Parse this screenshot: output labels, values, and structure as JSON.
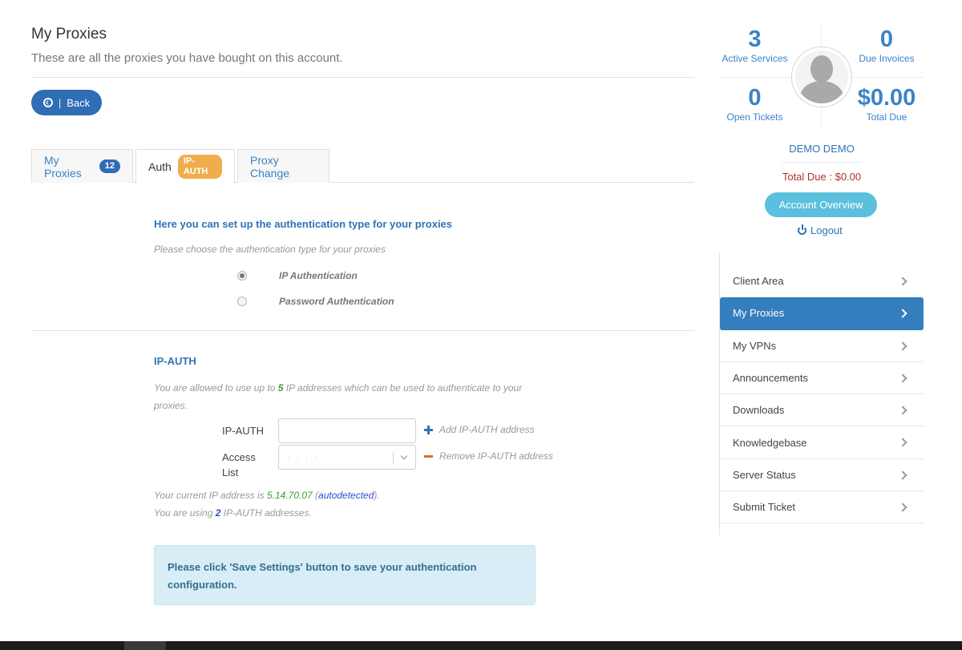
{
  "header": {
    "title": "My Proxies",
    "subtitle": "These are all the proxies you have bought on this account.",
    "back_label": "Back",
    "back_sep": "|"
  },
  "tabs": [
    {
      "label": "My Proxies",
      "badge": "12"
    },
    {
      "label": "Auth",
      "badge": "IP-AUTH"
    },
    {
      "label": "Proxy Change"
    }
  ],
  "auth": {
    "title": "Here you can set up the authentication type for your proxies",
    "hint": "Please choose the authentication type for your proxies",
    "options": [
      {
        "label": "IP Authentication",
        "checked": true
      },
      {
        "label": "Password Authentication",
        "checked": false
      }
    ]
  },
  "ipauth": {
    "title": "IP-AUTH",
    "allowed_prefix": "You are allowed to use up to ",
    "allowed_count": "5",
    "allowed_suffix": " IP addresses which can be used to authenticate to your proxies.",
    "input_label": "IP-AUTH",
    "input_value": "",
    "access_label": "Access List",
    "access_value": "·  ·  ·  ·",
    "add_label": "Add IP-AUTH address",
    "remove_label": "Remove IP-AUTH address",
    "current_prefix": "Your current IP address is ",
    "current_ip": "5.14.70.07",
    "current_paren_open": " (",
    "autodetected": "autodetected",
    "current_paren_close": ").",
    "using_prefix": "You are using ",
    "using_count": "2",
    "using_suffix": " IP-AUTH addresses.",
    "save_notice": "Please click 'Save Settings' button to save your authentication configuration."
  },
  "stats": {
    "active_services": {
      "value": "3",
      "label": "Active Services"
    },
    "due_invoices": {
      "value": "0",
      "label": "Due Invoices"
    },
    "open_tickets": {
      "value": "0",
      "label": "Open Tickets"
    },
    "total_due": {
      "value": "$0.00",
      "label": "Total Due"
    }
  },
  "account": {
    "name": "DEMO DEMO",
    "total_due_text": "Total Due : $0.00",
    "overview_label": "Account Overview",
    "logout_label": "Logout"
  },
  "nav": [
    {
      "label": "Client Area"
    },
    {
      "label": "My Proxies",
      "active": true
    },
    {
      "label": "My VPNs"
    },
    {
      "label": "Announcements"
    },
    {
      "label": "Downloads"
    },
    {
      "label": "Knowledgebase"
    },
    {
      "label": "Server Status"
    },
    {
      "label": "Submit Ticket"
    }
  ],
  "colors": {
    "primary": "#2f6db5",
    "link": "#3a84c7",
    "badge_orange": "#f0ad4e",
    "info_bg": "#d9edf7",
    "due_red": "#b03030"
  }
}
